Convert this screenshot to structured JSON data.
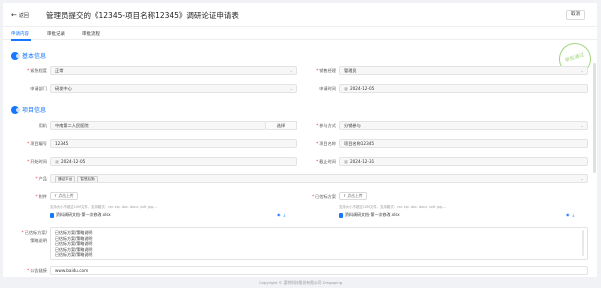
{
  "header": {
    "back_label": "返回",
    "title": "管理员提交的《12345-项目名称12345》调研论证申请表",
    "cancel_label": "取消"
  },
  "tabs": [
    {
      "label": "申请内容",
      "active": true
    },
    {
      "label": "审批记录",
      "active": false
    },
    {
      "label": "审批流程",
      "active": false
    }
  ],
  "stamp_text": "审批通过",
  "basic": {
    "section_title": "基本信息",
    "urgency_label": "紧急程度",
    "urgency_value": "正常",
    "manager_label": "销售经理",
    "manager_value": "管理员",
    "dept_label": "申请部门",
    "dept_value": "研发中心",
    "date_label": "申请时间",
    "date_value": "2024-12-05"
  },
  "project": {
    "section_title": "项目信息",
    "customer_label": "用机",
    "customer_value": "中南第二人民医院",
    "select_label": "选择",
    "join_label": "参与方式",
    "join_value": "分销参与",
    "code_label": "项目编号",
    "code_value": "12345",
    "name_label": "项目名称",
    "name_value": "项目名称12345",
    "start_label": "开始时间",
    "start_value": "2024-12-05",
    "end_label": "截止时间",
    "end_value": "2024-12-31",
    "product_label": "产品",
    "product_tags": [
      "通证平台",
      "智慧后勤"
    ],
    "attach_label": "附件",
    "attach_upload": "点击上传",
    "attach_hint": "支持大小不超过10M文件，支持格式：rar. zip. doc. docx. pdf. jpg....",
    "attach_file": "资料调研文档-第一次修改.xlsx",
    "proposal_label": "已估标方案",
    "proposal_upload": "点击上传",
    "proposal_hint": "支持大小不超过10M文件，支持格式：rar. zip. doc. docx. pdf. jpg....",
    "proposal_file": "资料调研文档-第一次修改.xlsx",
    "desc_label_1": "已估标方案/",
    "desc_label_2": "策略说明",
    "desc_lines": [
      "已估标方案/策略说明",
      "已估标方案/策略说明",
      "已估标方案/策略说明",
      "已估标方案/策略说明",
      "已估标方案/策略说明"
    ],
    "link_label": "公告链接",
    "link_value": "www.baidu.com"
  },
  "footer_text": "Copyright © 惠特科技股份有限公司 Dingoping"
}
